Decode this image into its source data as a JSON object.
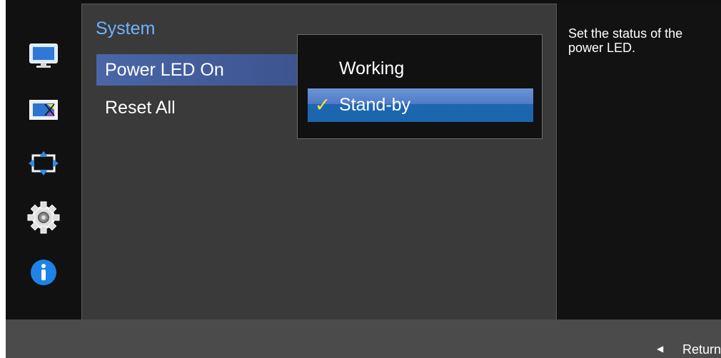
{
  "window": {
    "title": "System"
  },
  "sidebar": {
    "items": [
      {
        "icon": "monitor-icon"
      },
      {
        "icon": "color-icon"
      },
      {
        "icon": "size-position-icon"
      },
      {
        "icon": "settings-gear-icon"
      },
      {
        "icon": "info-icon"
      }
    ]
  },
  "menu": {
    "items": [
      {
        "label": "Power LED On"
      },
      {
        "label": "Reset All"
      }
    ]
  },
  "submenu": {
    "options": [
      {
        "label": "Working"
      },
      {
        "label": "Stand-by"
      }
    ],
    "selected": "Stand-by"
  },
  "help": {
    "text": "Set the status of the power LED."
  },
  "bottom": {
    "return_label": "Return"
  },
  "colors": {
    "title_blue": "#6fb2ff",
    "highlight_blue": "#4a66a7",
    "selection_blue": "#1e67b0",
    "check_yellow": "#f4e244"
  }
}
